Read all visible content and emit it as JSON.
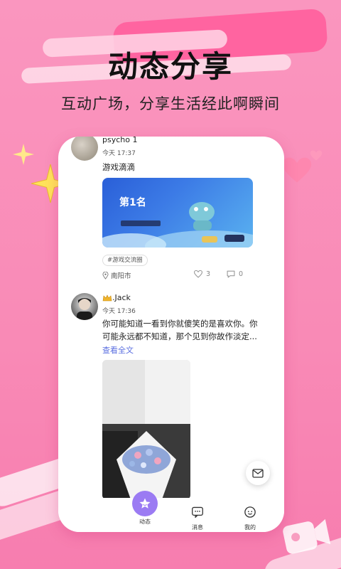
{
  "promo": {
    "headline": "动态分享",
    "subtitle": "互动广场，分享生活经此啊瞬间"
  },
  "feed": {
    "posts": [
      {
        "username": "psycho 1",
        "time": "今天 17:37",
        "text": "游戏滴滴",
        "image_caption": "第1名",
        "tag": "#游戏交流圈",
        "location": "南阳市",
        "likes": "3",
        "comments": "0"
      },
      {
        "username": ".Jack",
        "time": "今天 17:36",
        "text": "你可能知道一看到你就傻笑的是喜欢你。你可能永远都不知道，那个见到你故作淡定...",
        "more_label": "查看全文"
      }
    ]
  },
  "tabbar": {
    "items": [
      {
        "label": "动态",
        "icon": "star-icon",
        "active": true
      },
      {
        "label": "消息",
        "icon": "message-icon",
        "active": false
      },
      {
        "label": "我的",
        "icon": "face-icon",
        "active": false
      }
    ]
  },
  "colors": {
    "background": "#fa96bf",
    "accent": "#9b7bf3",
    "link": "#5b6fe0"
  }
}
